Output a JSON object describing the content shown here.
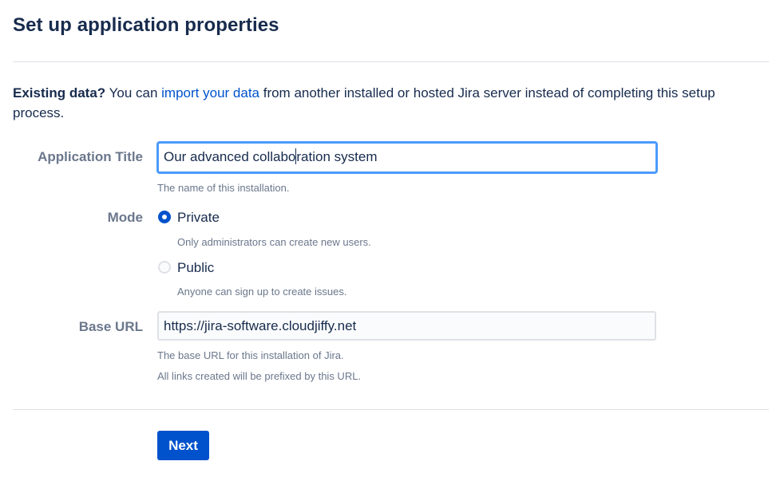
{
  "page": {
    "title": "Set up application properties"
  },
  "intro": {
    "bold": "Existing data?",
    "before_link": " You can ",
    "link": "import your data",
    "after_link": " from another installed or hosted Jira server instead of completing this setup process."
  },
  "fields": {
    "app_title": {
      "label": "Application Title",
      "value_before_caret": "Our advanced collabo",
      "value_after_caret": "ration system",
      "help": "The name of this installation."
    },
    "mode": {
      "label": "Mode",
      "options": [
        {
          "label": "Private",
          "description": "Only administrators can create new users.",
          "selected": true
        },
        {
          "label": "Public",
          "description": "Anyone can sign up to create issues.",
          "selected": false
        }
      ]
    },
    "base_url": {
      "label": "Base URL",
      "value": "https://jira-software.cloudjiffy.net",
      "help_line1": "The base URL for this installation of Jira.",
      "help_line2": "All links created will be prefixed by this URL."
    }
  },
  "actions": {
    "next_label": "Next"
  },
  "colors": {
    "primary": "#0052cc",
    "focus_ring": "#4c9aff",
    "label_gray": "#6b778c",
    "text": "#172b4d",
    "divider": "#dfe1e6"
  }
}
